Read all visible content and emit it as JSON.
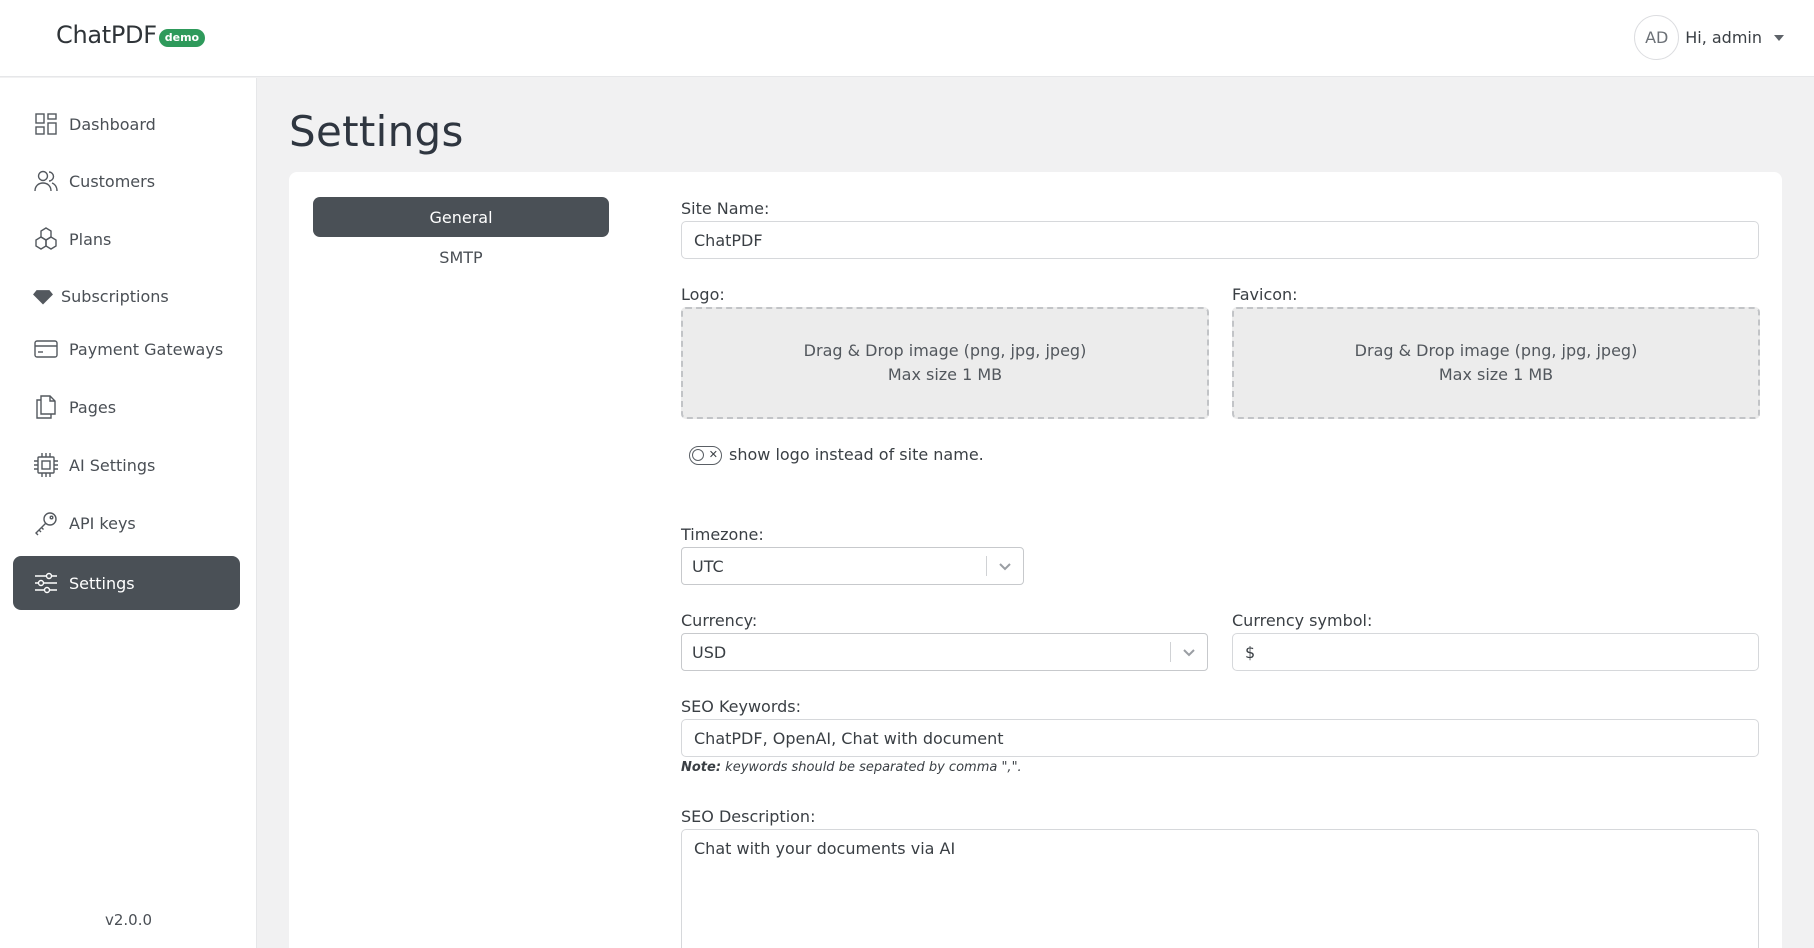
{
  "header": {
    "brand_name": "ChatPDF",
    "brand_badge": "demo",
    "avatar_initials": "AD",
    "greeting": "Hi, admin"
  },
  "sidebar": {
    "items": [
      {
        "label": "Dashboard",
        "icon": "dashboard-icon"
      },
      {
        "label": "Customers",
        "icon": "users-icon"
      },
      {
        "label": "Plans",
        "icon": "cubes-icon"
      },
      {
        "label": "Subscriptions",
        "icon": "diamond-icon"
      },
      {
        "label": "Payment Gateways",
        "icon": "credit-card-icon"
      },
      {
        "label": "Pages",
        "icon": "pages-icon"
      },
      {
        "label": "AI Settings",
        "icon": "cpu-icon"
      },
      {
        "label": "API keys",
        "icon": "key-icon"
      },
      {
        "label": "Settings",
        "icon": "sliders-icon",
        "active": true
      }
    ],
    "version": "v2.0.0"
  },
  "page": {
    "title": "Settings"
  },
  "tabs": [
    {
      "label": "General",
      "active": true
    },
    {
      "label": "SMTP"
    }
  ],
  "form": {
    "site_name_label": "Site Name:",
    "site_name_value": "ChatPDF",
    "logo_label": "Logo:",
    "favicon_label": "Favicon:",
    "dropzone_line1": "Drag & Drop image (png, jpg, jpeg)",
    "dropzone_line2": "Max size 1 MB",
    "show_logo_label": "show logo instead of site name.",
    "show_logo_enabled": false,
    "timezone_label": "Timezone:",
    "timezone_value": "UTC",
    "currency_label": "Currency:",
    "currency_value": "USD",
    "currency_symbol_label": "Currency symbol:",
    "currency_symbol_value": "$",
    "seo_keywords_label": "SEO Keywords:",
    "seo_keywords_value": "ChatPDF, OpenAI, Chat with document",
    "note_prefix": "Note:",
    "note_text": " keywords should be separated by comma \",\".",
    "seo_description_label": "SEO Description:",
    "seo_description_value": "Chat with your documents via AI"
  },
  "colors": {
    "active_bg": "#4a5056",
    "badge": "#2e9a5b",
    "page_bg": "#f1f1f2"
  }
}
